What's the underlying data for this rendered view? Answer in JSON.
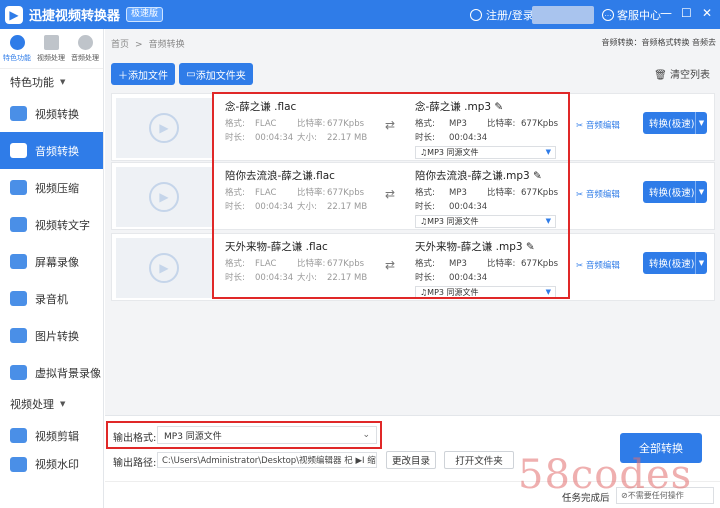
{
  "app": {
    "title": "迅捷视频转换器",
    "badge": "极速版",
    "login": "注册/登录",
    "service": "客服中心",
    "win_min": "—",
    "win_max": "☐",
    "win_close": "✕"
  },
  "sidebar": {
    "tabs": [
      "特色功能",
      "视频处理",
      "音频处理"
    ],
    "section1": "特色功能",
    "items": [
      "视频转换",
      "音频转换",
      "视频压缩",
      "视频转文字",
      "屏幕录像",
      "录音机",
      "图片转换",
      "虚拟背景录像"
    ],
    "section2": "视频处理",
    "items2": [
      "视频剪辑",
      "视频水印"
    ]
  },
  "breadcrumb": {
    "home": "首页",
    "sep": ">",
    "current": "音频转换"
  },
  "settings": "音频转换：音频格式转换  音频去",
  "toolbar": {
    "add_file": "添加文件",
    "add_folder": "添加文件夹",
    "clear": "清空列表"
  },
  "rows": [
    {
      "src": "念-薛之谦 .flac",
      "fmt": "FLAC",
      "bitrate": "677Kpbs",
      "dur": "00:04:34",
      "size": "22.17 MB",
      "out": "念-薛之谦 .mp3",
      "ofmt": "MP3",
      "obit": "677Kpbs",
      "odur": "00:04:34",
      "sel": "MP3   同源文件"
    },
    {
      "src": "陪你去流浪-薛之谦.flac",
      "fmt": "FLAC",
      "bitrate": "677Kpbs",
      "dur": "00:04:34",
      "size": "22.17 MB",
      "out": "陪你去流浪-薛之谦.mp3",
      "ofmt": "MP3",
      "obit": "677Kpbs",
      "odur": "00:04:34",
      "sel": "MP3   同源文件"
    },
    {
      "src": "天外来物-薛之谦 .flac",
      "fmt": "FLAC",
      "bitrate": "677Kpbs",
      "dur": "00:04:34",
      "size": "22.17 MB",
      "out": "天外来物-薛之谦 .mp3",
      "ofmt": "MP3",
      "obit": "677Kpbs",
      "odur": "00:04:34",
      "sel": "MP3   同源文件"
    }
  ],
  "labels": {
    "fmt": "格式:",
    "bit": "比特率:",
    "dur": "时长:",
    "size": "大小:",
    "audio_edit": "音频编辑",
    "convert": "转换(极速)"
  },
  "bottom": {
    "out_fmt_label": "输出格式:",
    "out_fmt": "MP3   同源文件",
    "out_path_label": "输出路径:",
    "path": "C:\\Users\\Administrator\\Desktop\\视频编辑器  杞 ▶I  缩略",
    "change_dir": "更改目录",
    "open_folder": "打开文件夹",
    "convert_all": "全部转换"
  },
  "status": {
    "done_label": "任务完成后",
    "done_value": "不需要任何操作"
  },
  "watermark": "58codes"
}
